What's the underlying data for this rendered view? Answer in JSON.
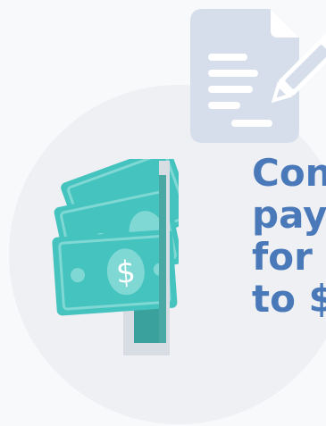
{
  "colors": {
    "background": "#f8f9fb",
    "circle": "#eef0f3",
    "document": "#d5deea",
    "document_lines": "#ffffff",
    "money": "#45c3bf",
    "money_dark": "#3aa8a4",
    "slot": "#d7dde3",
    "slot_inner": "#3aa19c",
    "headline": "#4a79b9"
  },
  "icons": {
    "document": "document-with-pencil-icon",
    "money": "dollar-bills-icon"
  },
  "headline": {
    "line1": "Con",
    "line2": "pay",
    "line3": "for c",
    "line4": "to $"
  },
  "money": {
    "symbol": "$"
  }
}
